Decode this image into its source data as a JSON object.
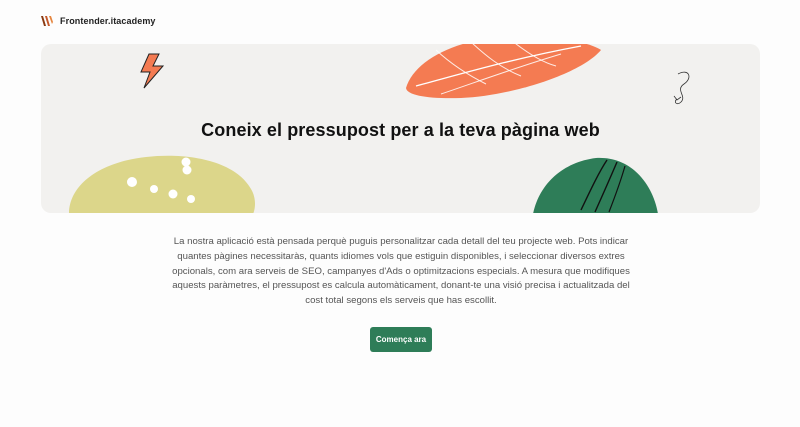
{
  "header": {
    "brand": "Frontender.itacademy",
    "logo_icon": "frontender-logo-icon"
  },
  "hero": {
    "title": "Coneix el pressupost per a la teva pàgina web",
    "decorations": [
      "lightning-bolt-icon",
      "orange-leaf-shape",
      "scribble-arrow-icon",
      "yellow-dotted-blob",
      "green-leaf-shape"
    ],
    "colors": {
      "background": "#f2f1ef",
      "orange": "#f47b52",
      "yellow": "#dcd68a",
      "green": "#2e7d58"
    }
  },
  "description": "La nostra aplicació està pensada perquè puguis personalitzar cada detall del teu projecte web. Pots indicar quantes pàgines necessitaràs, quants idiomes vols que estiguin disponibles, i seleccionar diversos extres opcionals, com ara serveis de SEO, campanyes d'Ads o optimitzacions especials. A mesura que modifiques aquests paràmetres, el pressupost es calcula automàticament, donant-te una visió precisa i actualitzada del cost total segons els serveis que has escollit.",
  "cta": {
    "label": "Comença ara",
    "color": "#2e7d58"
  }
}
